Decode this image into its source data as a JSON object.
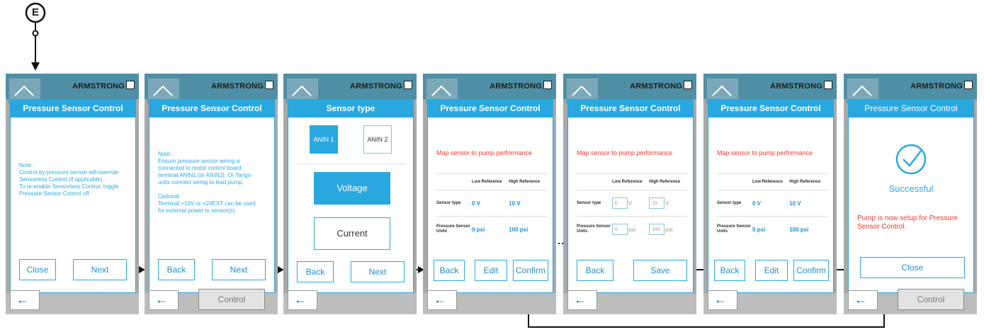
{
  "start_marker": "E",
  "brand": "ARMSTRONG",
  "control_label": "Control",
  "screens": {
    "s1": {
      "title": "Pressure Sensor Control",
      "note": "Note:\nControl by pressure sensor will override\nSensorless Control (if applicable).\nTo re-enable Sensorless Control, toggle\nPressure Sensor Control off",
      "left": "Close",
      "right": "Next"
    },
    "s2": {
      "title": "Pressure Sensor Control",
      "note": "Note:\nEnsure pressure sensor wiring is\nconnected to motor control board\nterminal ANIN1 (or ANIN2). Or Tango\nunits connect wiring to lead pump.\n\nOptional:\nTerminal +10V or +24EXT can be used\nfor external power to sensor(s).",
      "left": "Back",
      "right": "Next"
    },
    "s3": {
      "title": "Sensor type",
      "anin1": "ANIN 1",
      "anin2": "ANIN 2",
      "voltage": "Voltage",
      "current": "Current",
      "left": "Back",
      "right": "Next"
    },
    "s4": {
      "title": "Pressure Sensor Control",
      "heading": "Map sensor to pump performance",
      "col_low": "Low Reference",
      "col_high": "High Reference",
      "row1": "Sensor type",
      "row2": "Pressure Sensor Units",
      "v_low": "0 V",
      "v_high": "10 V",
      "p_low": "0 psi",
      "p_high": "100 psi",
      "b1": "Back",
      "b2": "Edit",
      "b3": "Confirm"
    },
    "s5": {
      "title": "Pressure Sensor Control",
      "heading": "Map sensor to pump performance",
      "col_low": "Low Reference",
      "col_high": "High Reference",
      "row1": "Sensor type",
      "row2": "Pressure Sensor Units",
      "in_v_low": "0",
      "in_v_high": "10",
      "in_p_low": "0",
      "in_p_high": "100",
      "unit_v": "V",
      "unit_p": "psi",
      "b1": "Back",
      "b2": "Save"
    },
    "s6": {
      "title": "Pressure Sensor Control",
      "heading": "Map sensor to pump performance",
      "col_low": "Low Reference",
      "col_high": "High Reference",
      "row1": "Sensor type",
      "row2": "Pressure Sensor Units",
      "v_low": "0 V",
      "v_high": "10 V",
      "p_low": "0 psi",
      "p_high": "100 psi",
      "b1": "Back",
      "b2": "Edit",
      "b3": "Confirm"
    },
    "s7": {
      "title": "Pressure Sensor Control",
      "status": "Successful",
      "message": "Pump is now setup for Pressure Sensor Control.",
      "b1": "Close"
    }
  },
  "colors": {
    "accent": "#29a8e0",
    "header": "#4f8fa6",
    "error": "#e8372b"
  }
}
